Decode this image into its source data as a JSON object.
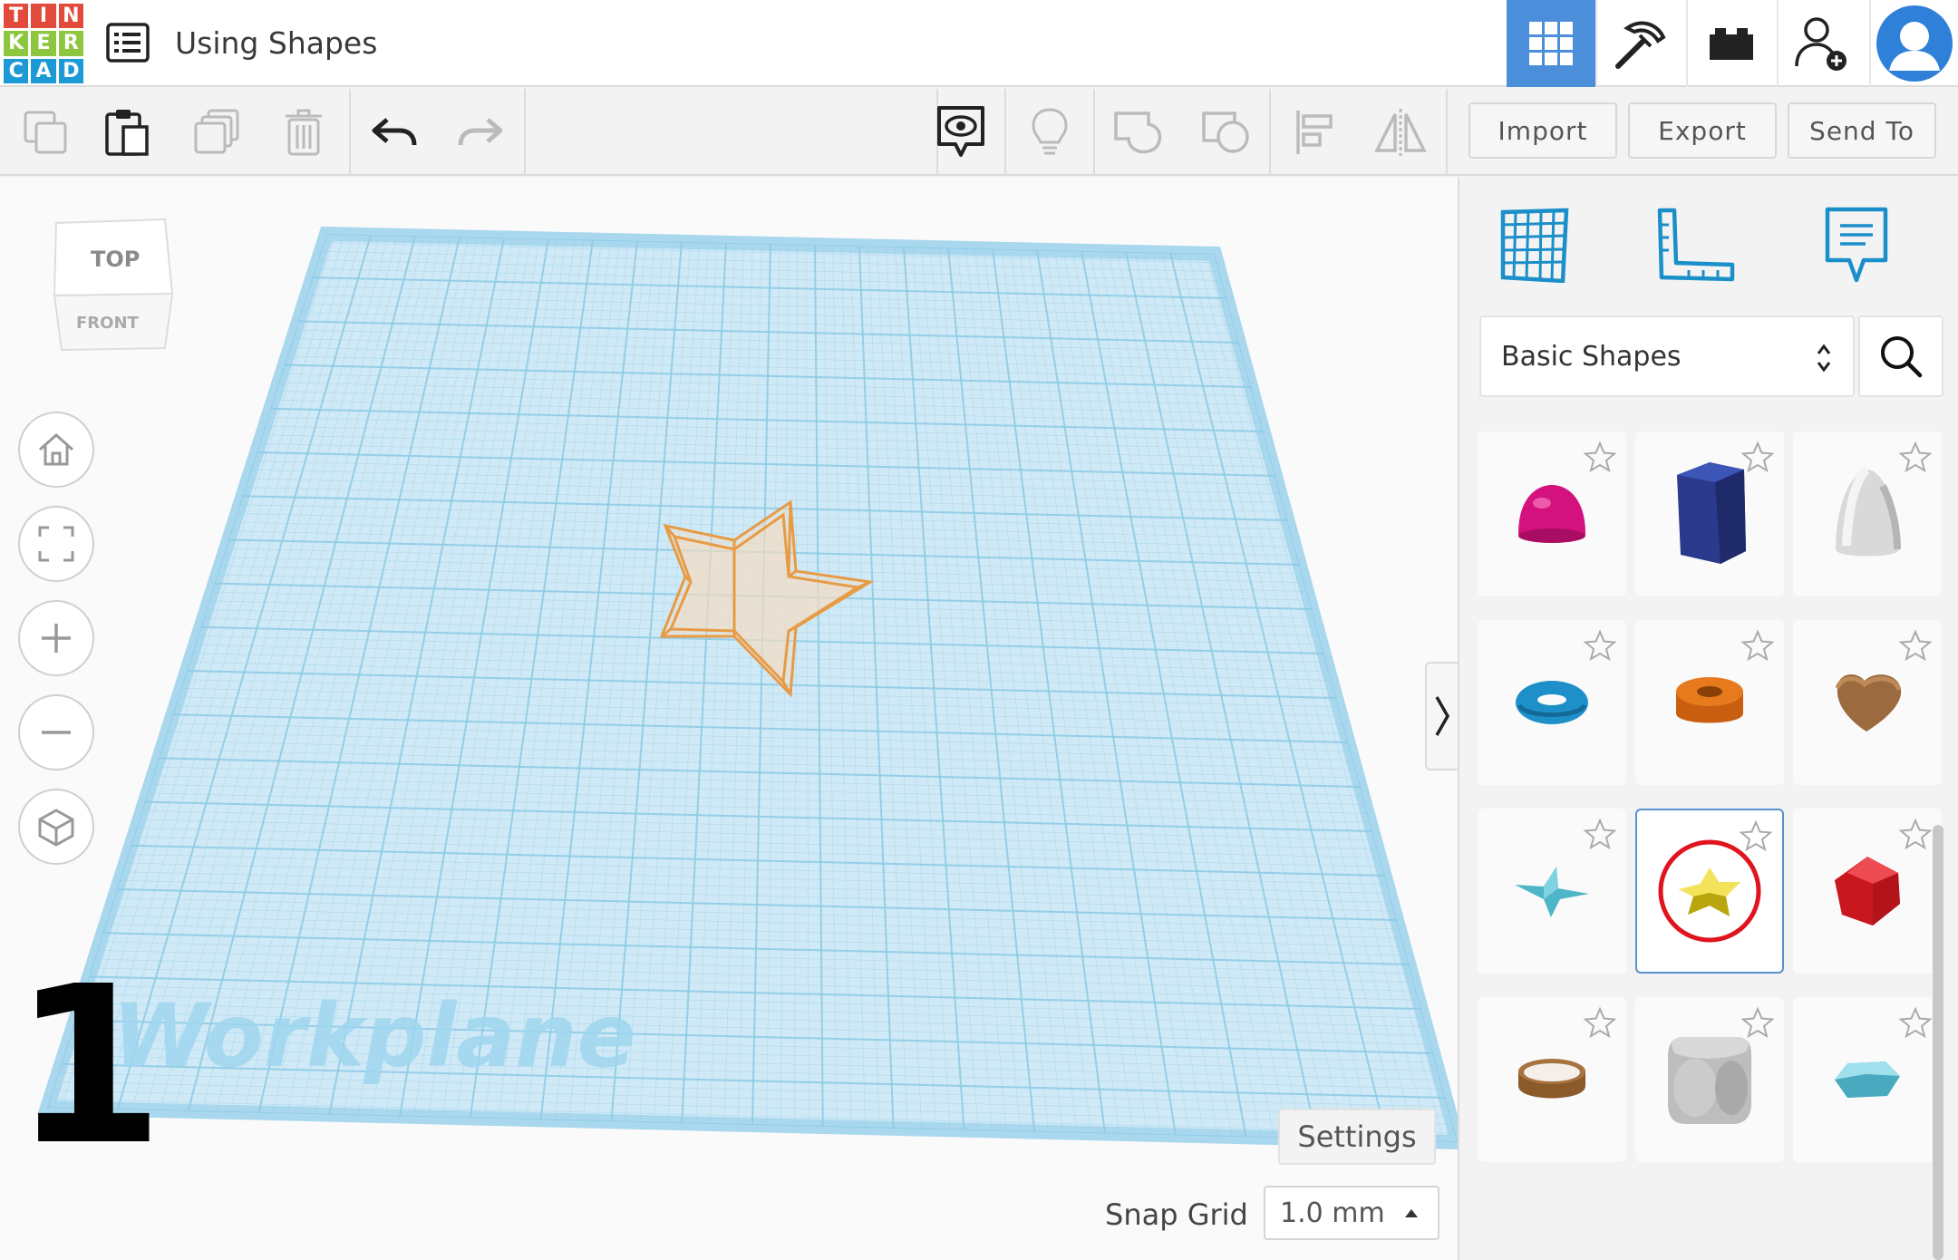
{
  "logo": {
    "letters": [
      "T",
      "I",
      "N",
      "K",
      "E",
      "R",
      "C",
      "A",
      "D"
    ]
  },
  "header": {
    "title": "Using Shapes",
    "nav": [
      {
        "icon": "grid-3d-icon",
        "active": true
      },
      {
        "icon": "pickaxe-icon"
      },
      {
        "icon": "bricks-icon"
      },
      {
        "icon": "add-user-icon"
      },
      {
        "icon": "avatar-icon"
      }
    ]
  },
  "toolbar": {
    "left_tools": [
      "copy-icon",
      "paste-icon",
      "duplicate-icon",
      "delete-icon",
      "undo-icon",
      "redo-icon"
    ],
    "right_tools": [
      "notes-visibility-icon",
      "lightbulb-icon",
      "group-icon",
      "ungroup-icon",
      "align-icon",
      "mirror-icon"
    ],
    "import_label": "Import",
    "export_label": "Export",
    "send_to_label": "Send To"
  },
  "viewport": {
    "viewcube": {
      "top_label": "TOP",
      "front_label": "FRONT"
    },
    "workplane_label": "Workplane",
    "step_number": "1",
    "settings_label": "Settings",
    "snap_grid_label": "Snap Grid",
    "snap_grid_value": "1.0 mm",
    "nav_buttons": [
      "home-icon",
      "fit-icon",
      "zoom-in-icon",
      "zoom-out-icon",
      "perspective-icon"
    ]
  },
  "panel": {
    "tools": [
      "workplane-icon",
      "ruler-icon",
      "notes-icon"
    ],
    "category": "Basic Shapes",
    "shapes": [
      {
        "name": "half-sphere",
        "color": "#d4127f"
      },
      {
        "name": "polygon",
        "color": "#2b3a8c"
      },
      {
        "name": "paraboloid",
        "color": "#d9d9d9"
      },
      {
        "name": "torus",
        "color": "#1e8fc8"
      },
      {
        "name": "tube",
        "color": "#e87a1e"
      },
      {
        "name": "heart",
        "color": "#9b6a3e"
      },
      {
        "name": "star-flat",
        "color": "#4fb6c8"
      },
      {
        "name": "star",
        "color": "#e8d21e",
        "selected": true
      },
      {
        "name": "icosahedron",
        "color": "#d81e26"
      },
      {
        "name": "ring",
        "color": "#8b5a2b"
      },
      {
        "name": "rounded-cube",
        "color": "#bdbdbd"
      },
      {
        "name": "diamond",
        "color": "#6cc9dc"
      }
    ]
  },
  "colors": {
    "active_nav": "#4b8ed9",
    "workplane": "#cfe9f6",
    "grid_line": "#8fcbe6",
    "selection_ring": "#e0141e"
  }
}
